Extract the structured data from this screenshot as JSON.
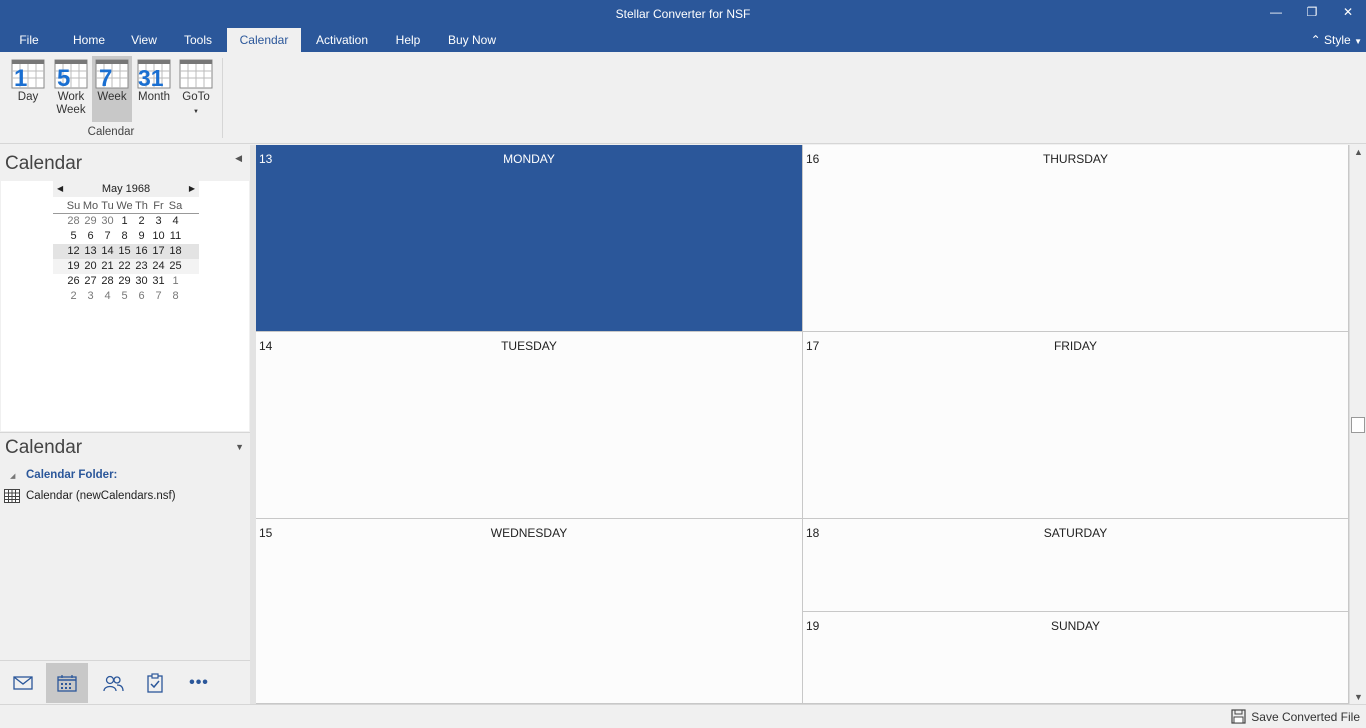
{
  "window": {
    "title": "Stellar Converter for NSF"
  },
  "menu": {
    "tabs": [
      {
        "label": "File"
      },
      {
        "label": "Home"
      },
      {
        "label": "View"
      },
      {
        "label": "Tools"
      },
      {
        "label": "Calendar"
      },
      {
        "label": "Activation"
      },
      {
        "label": "Help"
      },
      {
        "label": "Buy Now"
      }
    ],
    "active_tab": "Calendar",
    "style_label": "Style"
  },
  "ribbon": {
    "buttons": [
      {
        "label": "Day",
        "number": "1"
      },
      {
        "label": "Work Week",
        "number": "5"
      },
      {
        "label": "Week",
        "number": "7"
      },
      {
        "label": "Month",
        "number": "31"
      },
      {
        "label": "GoTo",
        "number": ""
      }
    ],
    "active_button": "Week",
    "group_label": "Calendar"
  },
  "left_pane": {
    "title": "Calendar",
    "minical": {
      "month_label": "May 1968",
      "dow": [
        "Su",
        "Mo",
        "Tu",
        "We",
        "Th",
        "Fr",
        "Sa"
      ],
      "weeks": [
        [
          "28",
          "29",
          "30",
          "1",
          "2",
          "3",
          "4"
        ],
        [
          "5",
          "6",
          "7",
          "8",
          "9",
          "10",
          "11"
        ],
        [
          "12",
          "13",
          "14",
          "15",
          "16",
          "17",
          "18"
        ],
        [
          "19",
          "20",
          "21",
          "22",
          "23",
          "24",
          "25"
        ],
        [
          "26",
          "27",
          "28",
          "29",
          "30",
          "31",
          "1"
        ],
        [
          "2",
          "3",
          "4",
          "5",
          "6",
          "7",
          "8"
        ]
      ]
    },
    "folder_pane_title": "Calendar",
    "folder_label": "Calendar Folder:",
    "folder_item": "Calendar (newCalendars.nsf)"
  },
  "calendar": {
    "days": [
      {
        "num": "13",
        "name": "MONDAY"
      },
      {
        "num": "14",
        "name": "TUESDAY"
      },
      {
        "num": "15",
        "name": "WEDNESDAY"
      },
      {
        "num": "16",
        "name": "THURSDAY"
      },
      {
        "num": "17",
        "name": "FRIDAY"
      },
      {
        "num": "18",
        "name": "SATURDAY"
      },
      {
        "num": "19",
        "name": "SUNDAY"
      }
    ],
    "selected_day": "13"
  },
  "status": {
    "save_label": "Save Converted File"
  },
  "colors": {
    "accent": "#2b579a",
    "ribbon_bg": "#f0f0f0",
    "selected_bg": "#c8c8c8"
  }
}
